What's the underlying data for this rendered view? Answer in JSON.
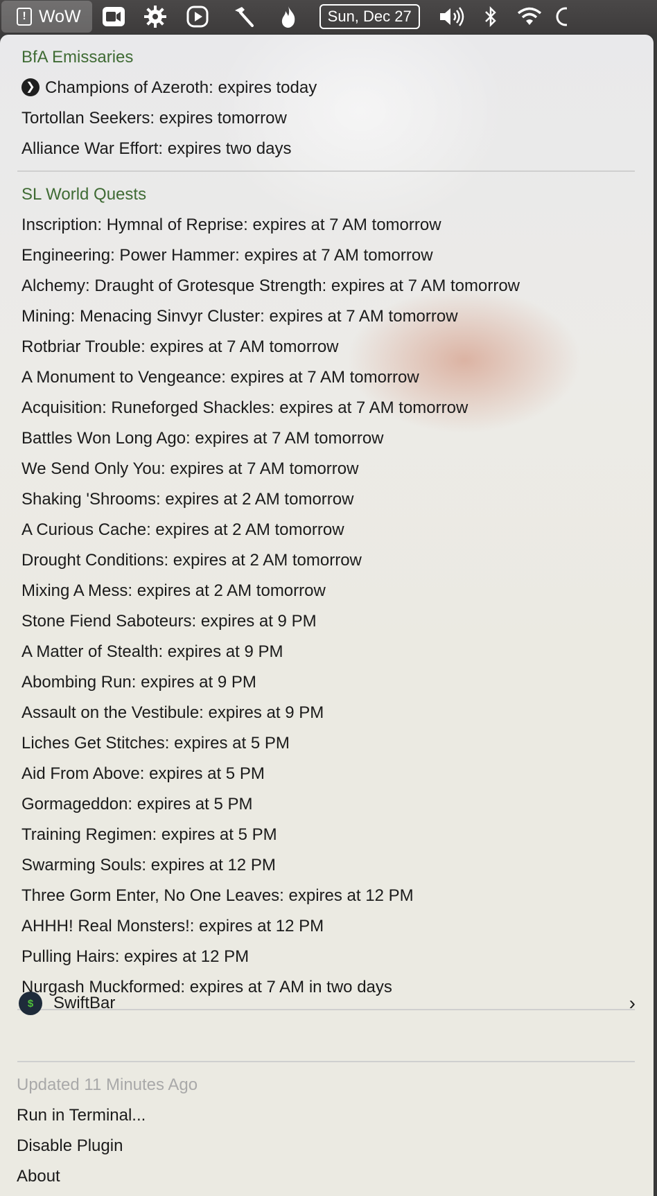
{
  "menubar": {
    "app_icon_glyph": "!",
    "app_title": "WoW",
    "date": "Sun, Dec 27",
    "icons": [
      "video-icon",
      "gear-icon",
      "play-icon",
      "hammer-icon",
      "flame-icon",
      "volume-icon",
      "bluetooth-icon",
      "wifi-icon"
    ]
  },
  "bfa": {
    "header": "BfA Emissaries",
    "items": [
      "Champions of Azeroth: expires today",
      "Tortollan Seekers: expires tomorrow",
      "Alliance War Effort: expires two days"
    ]
  },
  "sl": {
    "header": "SL World Quests",
    "items": [
      "Inscription: Hymnal of Reprise: expires at 7 AM tomorrow",
      "Engineering: Power Hammer: expires at 7 AM tomorrow",
      "Alchemy: Draught of Grotesque Strength: expires at 7 AM tomorrow",
      "Mining: Menacing Sinvyr Cluster: expires at 7 AM tomorrow",
      "Rotbriar Trouble: expires at 7 AM tomorrow",
      "A Monument to Vengeance: expires at 7 AM tomorrow",
      "Acquisition: Runeforged Shackles: expires at 7 AM tomorrow",
      "Battles Won Long Ago: expires at 7 AM tomorrow",
      "We Send Only You: expires at 7 AM tomorrow",
      "Shaking 'Shrooms: expires at 2 AM tomorrow",
      "A Curious Cache: expires at 2 AM tomorrow",
      "Drought Conditions: expires at 2 AM tomorrow",
      "Mixing A Mess: expires at 2 AM tomorrow",
      "Stone Fiend Saboteurs: expires at 9 PM",
      "A Matter of Stealth: expires at 9 PM",
      "Abombing Run: expires at 9 PM",
      "Assault on the Vestibule: expires at 9 PM",
      "Liches Get Stitches: expires at 5 PM",
      "Aid From Above: expires at 5 PM",
      "Gormageddon: expires at 5 PM",
      "Training Regimen: expires at 5 PM",
      "Swarming Souls: expires at 12 PM",
      "Three Gorm Enter, No One Leaves: expires at 12 PM",
      "AHHH! Real Monsters!: expires at 12 PM",
      "Pulling Hairs: expires at 12 PM",
      "Nurgash Muckformed: expires at 7 AM in two days"
    ]
  },
  "swiftbar": {
    "logo": "$",
    "label": "SwiftBar"
  },
  "footer": {
    "updated": "Updated 11 Minutes Ago",
    "run": "Run in Terminal...",
    "disable": "Disable Plugin",
    "about": "About"
  }
}
